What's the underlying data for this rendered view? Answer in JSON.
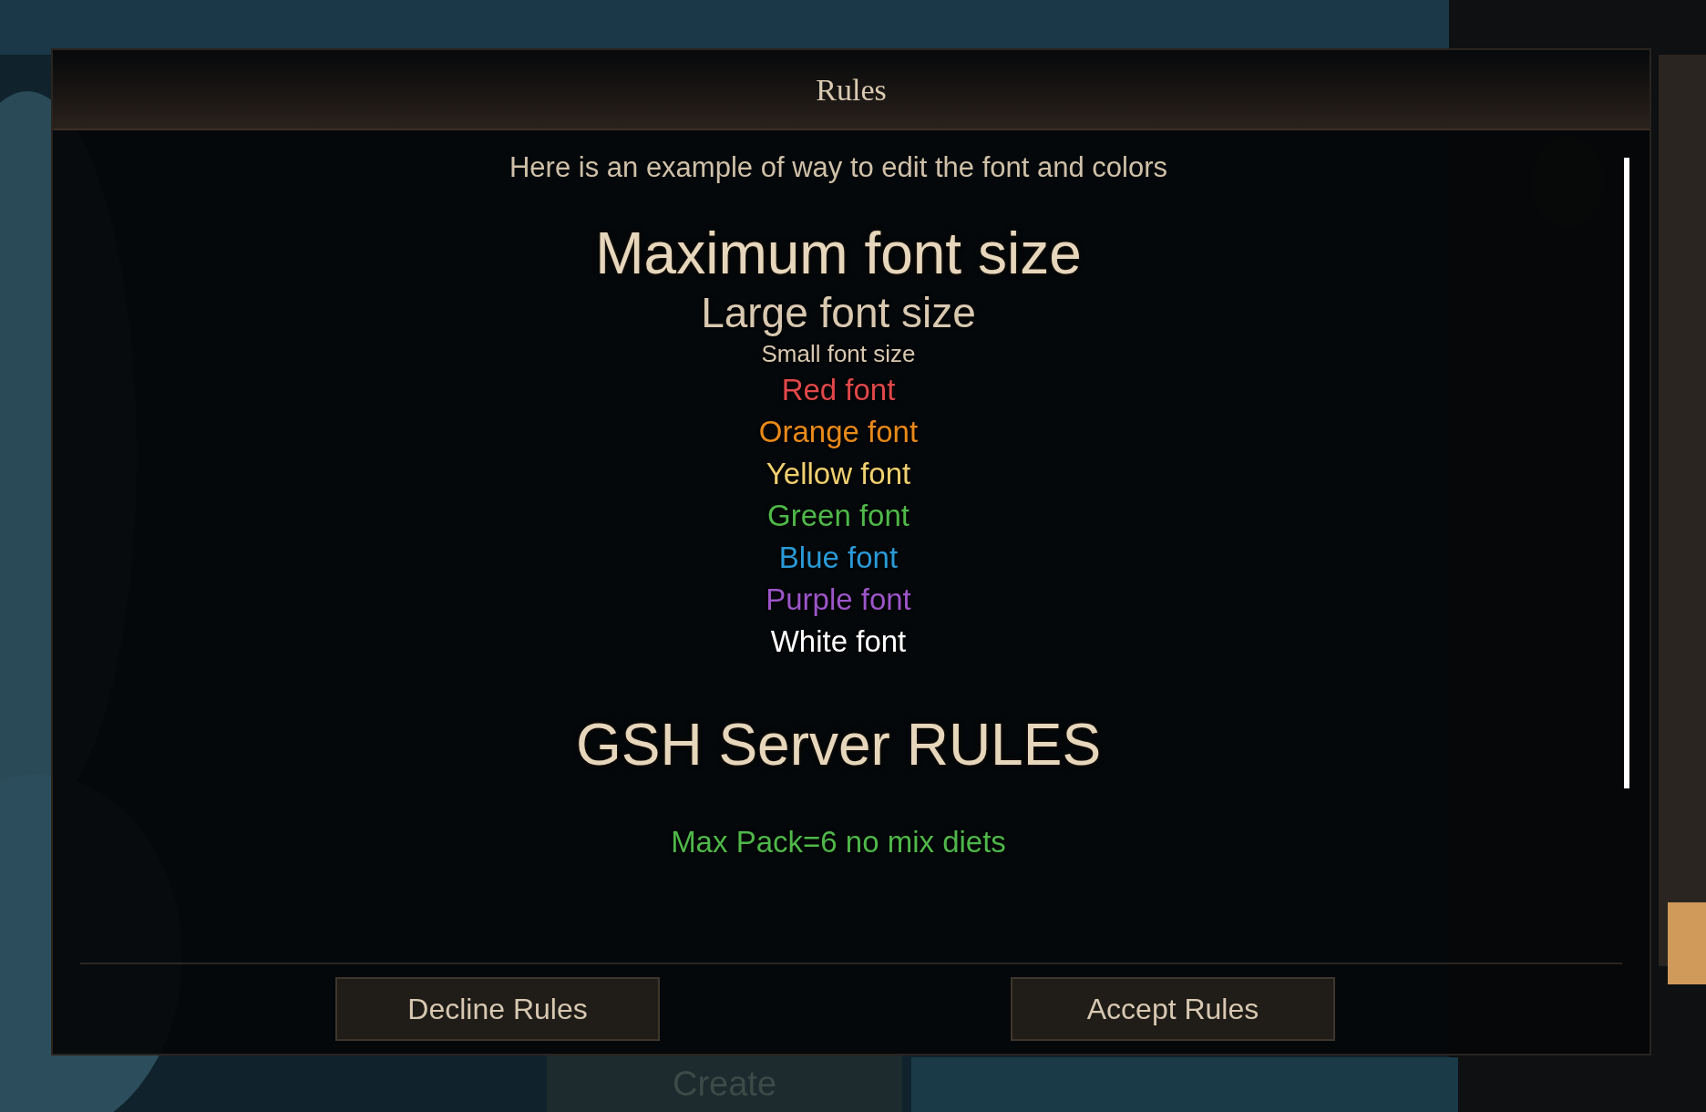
{
  "dialog": {
    "title": "Rules",
    "intro": "Here is an example of way to edit the font and colors",
    "lines": [
      {
        "text": "Maximum font size",
        "kind": "max",
        "color": "#e6d6bc"
      },
      {
        "text": "Large font size",
        "kind": "large",
        "color": "#d8c8b0"
      },
      {
        "text": "Small font size",
        "kind": "small",
        "color": "#d8c8b0"
      },
      {
        "text": "Red font",
        "kind": "normal",
        "color": "#e0484a"
      },
      {
        "text": "Orange font",
        "kind": "normal",
        "color": "#e88a1a"
      },
      {
        "text": "Yellow font",
        "kind": "normal",
        "color": "#f0d070"
      },
      {
        "text": "Green font",
        "kind": "normal",
        "color": "#4fb84a"
      },
      {
        "text": "Blue font",
        "kind": "normal",
        "color": "#2a9ad8"
      },
      {
        "text": "Purple font",
        "kind": "normal",
        "color": "#9b55c8"
      },
      {
        "text": "White font",
        "kind": "normal",
        "color": "#ffffff"
      },
      {
        "text": "GSH Server RULES",
        "kind": "max",
        "color": "#e6d6bc"
      },
      {
        "text": "Max Pack=6 no mix diets",
        "kind": "normal",
        "color": "#4fb84a"
      }
    ],
    "buttons": [
      "Decline Rules",
      "Accept Rules"
    ]
  },
  "background": {
    "button": "Create"
  }
}
